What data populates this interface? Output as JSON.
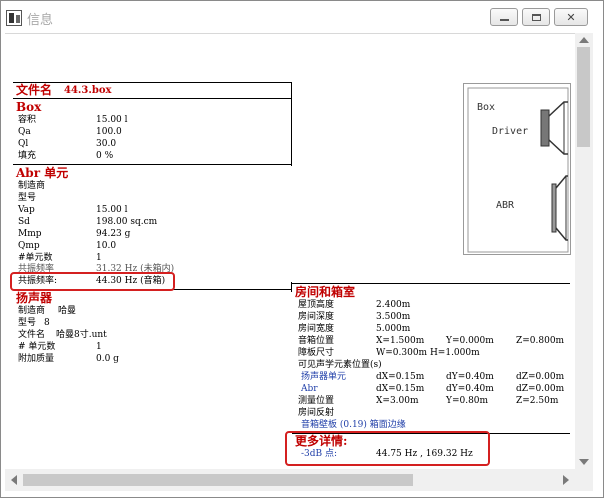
{
  "window": {
    "title": "信息",
    "close_glyph": "✕"
  },
  "file": {
    "label": "文件名",
    "name": "44.3.box"
  },
  "box": {
    "header": "Box",
    "rows": [
      {
        "label": "容积",
        "value": "15.00 l"
      },
      {
        "label": "Qa",
        "value": "100.0"
      },
      {
        "label": "Ql",
        "value": "30.0"
      },
      {
        "label": "填充",
        "value": "0 %"
      }
    ]
  },
  "abr": {
    "header": "Abr 单元",
    "rows": [
      {
        "label": "制造商",
        "value": ""
      },
      {
        "label": "型号",
        "value": ""
      },
      {
        "label": "Vap",
        "value": "15.00 l"
      },
      {
        "label": "Sd",
        "value": "198.00 sq.cm"
      },
      {
        "label": "Mmp",
        "value": "94.23 g"
      },
      {
        "label": "Qmp",
        "value": "10.0"
      },
      {
        "label": "#单元数",
        "value": "1"
      },
      {
        "label": "共振频率",
        "value": "31.32 Hz (未箱内)"
      },
      {
        "label": "共振频率:",
        "value": "44.30 Hz (音箱)"
      }
    ]
  },
  "speaker": {
    "header": "扬声器",
    "rows": [
      {
        "label": "制造商",
        "value": "哈曼"
      },
      {
        "label": "型号",
        "value": "8"
      },
      {
        "label": "文件名",
        "value": "哈曼8寸.unt"
      },
      {
        "label": "# 单元数",
        "value": "1"
      },
      {
        "label": "附加质量",
        "value": "0.0 g"
      }
    ]
  },
  "diagram": {
    "box_label": "Box",
    "driver_label": "Driver",
    "abr_label": "ABR"
  },
  "room": {
    "header": "房间和箱室",
    "rows": [
      {
        "label": "屋顶高度",
        "c1": "2.400m",
        "c2": "",
        "c3": ""
      },
      {
        "label": "房间深度",
        "c1": "3.500m",
        "c2": "",
        "c3": ""
      },
      {
        "label": "房间宽度",
        "c1": "5.000m",
        "c2": "",
        "c3": ""
      },
      {
        "label": "音箱位置",
        "c1": "X=1.500m",
        "c2": "Y=0.000m",
        "c3": "Z=0.800m"
      },
      {
        "label": "障板尺寸",
        "c1": "W=0.300m  H=1.000m",
        "c2": "",
        "c3": ""
      },
      {
        "label": "可见声学元素位置(s)",
        "c1": "",
        "c2": "",
        "c3": ""
      },
      {
        "label": "扬声器单元",
        "c1": "dX=0.15m",
        "c2": "dY=0.40m",
        "c3": "dZ=0.00m"
      },
      {
        "label": "Abr",
        "c1": "dX=0.15m",
        "c2": "dY=0.40m",
        "c3": "dZ=0.00m"
      },
      {
        "label": "测量位置",
        "c1": "X=3.00m",
        "c2": "Y=0.80m",
        "c3": "Z=2.50m"
      },
      {
        "label": "房间反射",
        "c1": "",
        "c2": "",
        "c3": ""
      }
    ],
    "link_row": "音箱壁板 (0.19)      箱面边缘"
  },
  "more": {
    "header": "更多详情:",
    "label": "-3dB 点:",
    "value": "44.75 Hz      ,  169.32 Hz"
  },
  "colors": {
    "header_red": "#c00000",
    "highlight_red": "#d42020",
    "link_blue": "#1f3ea8"
  }
}
